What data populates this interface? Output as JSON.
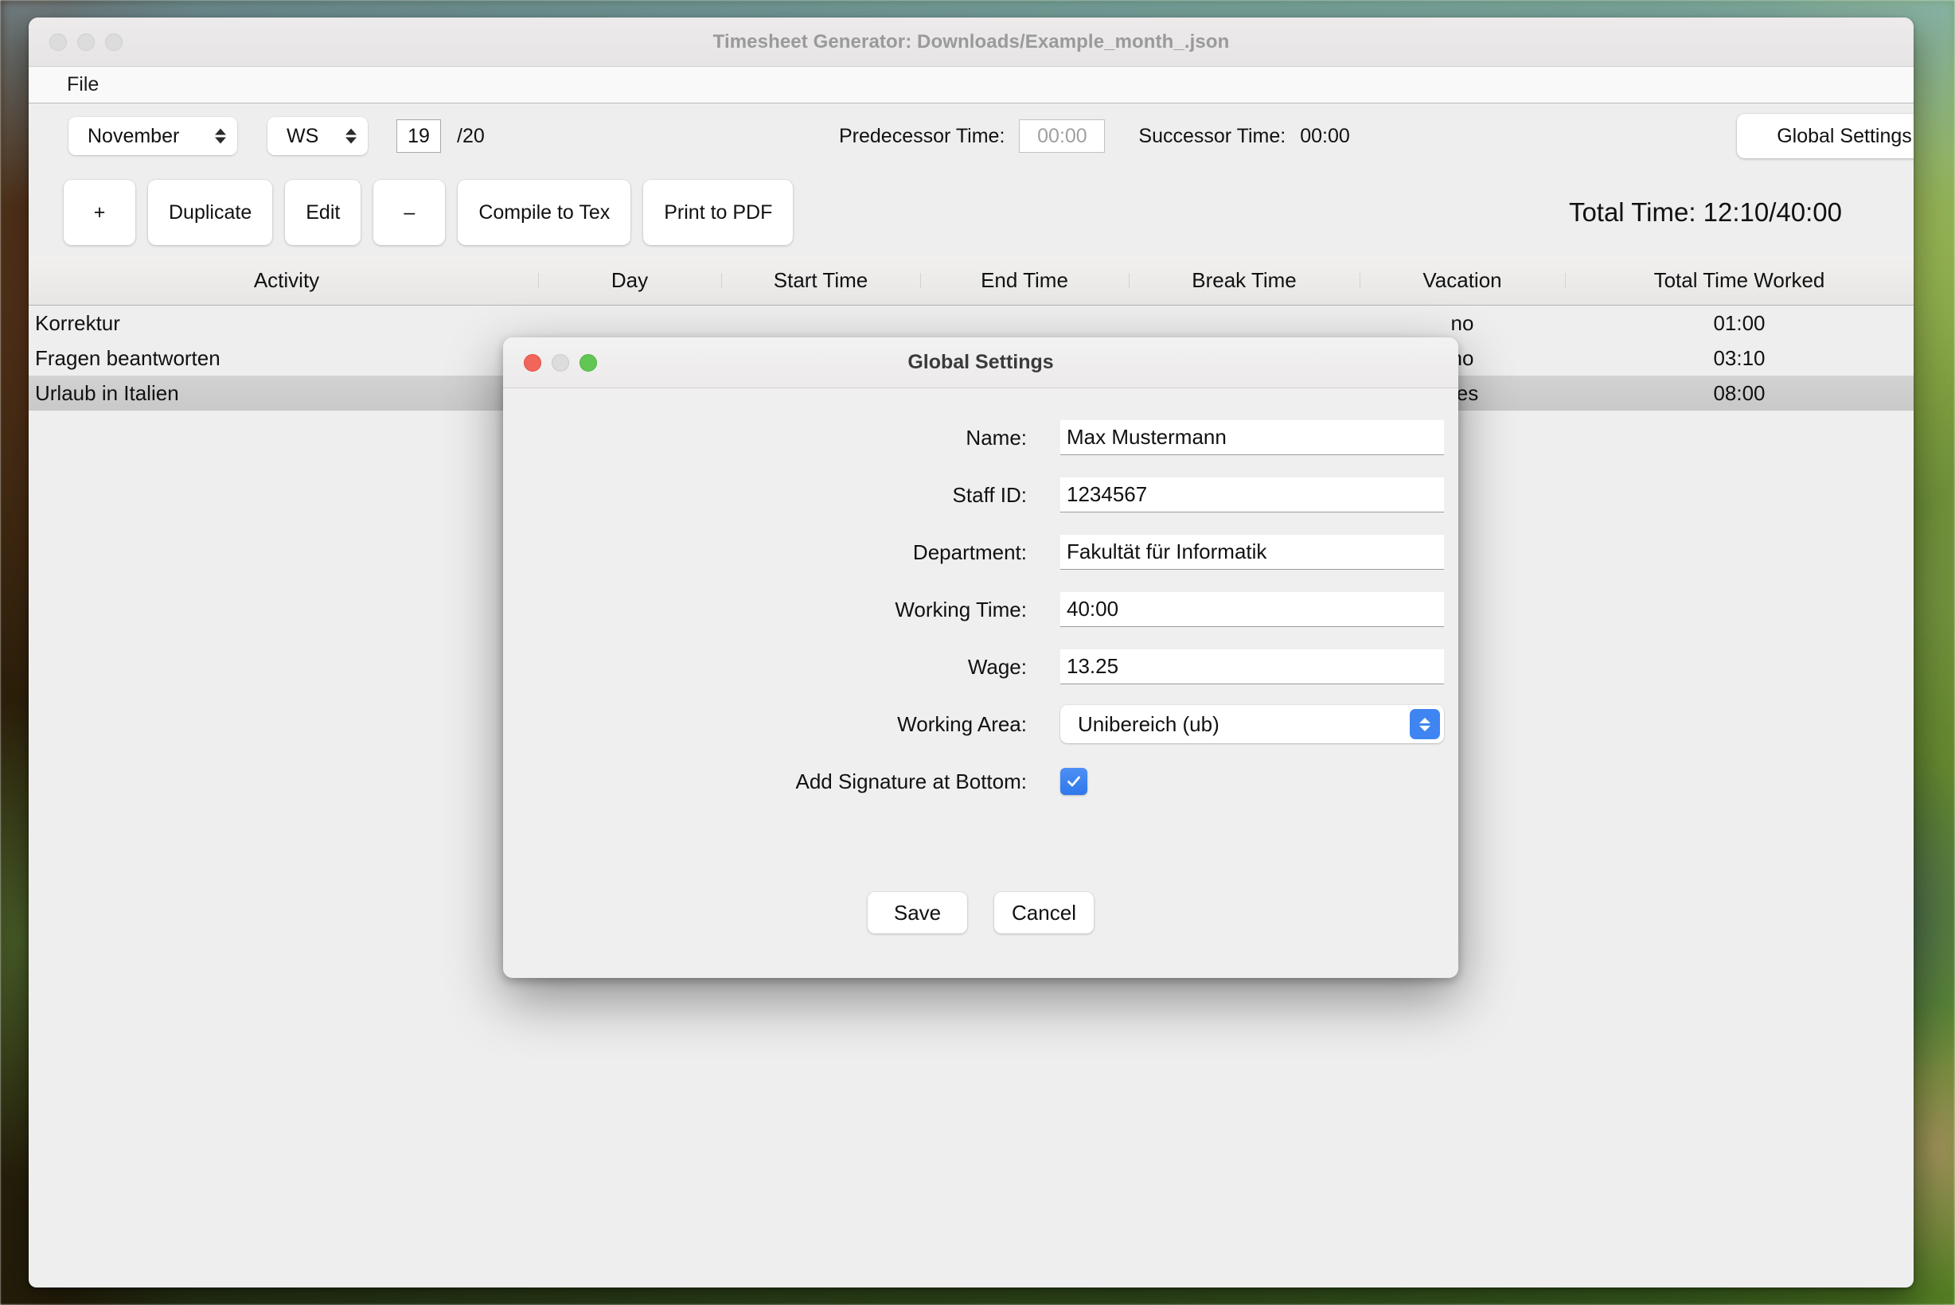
{
  "window": {
    "title": "Timesheet Generator: Downloads/Example_month_.json",
    "menu": {
      "file": "File"
    }
  },
  "toolbar": {
    "month": "November",
    "semester": "WS",
    "week_number": "19",
    "week_total": "/20",
    "predecessor_label": "Predecessor Time:",
    "predecessor_value": "00:00",
    "successor_label": "Successor Time:",
    "successor_value": "00:00",
    "global_settings": "Global Settings"
  },
  "actions": {
    "add": "+",
    "duplicate": "Duplicate",
    "edit": "Edit",
    "remove": "–",
    "compile": "Compile to Tex",
    "print": "Print to PDF",
    "total_time": "Total Time:  12:10/40:00"
  },
  "table": {
    "columns": [
      "Activity",
      "Day",
      "Start Time",
      "End Time",
      "Break Time",
      "Vacation",
      "Total Time Worked"
    ],
    "rows": [
      {
        "activity": "Korrektur",
        "day": "",
        "start": "",
        "end": "",
        "break": "",
        "vacation": "no",
        "total": "01:00",
        "selected": false
      },
      {
        "activity": "Fragen beantworten",
        "day": "",
        "start": "",
        "end": "",
        "break": "",
        "vacation": "no",
        "total": "03:10",
        "selected": false
      },
      {
        "activity": "Urlaub in Italien",
        "day": "",
        "start": "",
        "end": "",
        "break": "",
        "vacation": "yes",
        "total": "08:00",
        "selected": true
      }
    ]
  },
  "dialog": {
    "title": "Global Settings",
    "fields": {
      "name_label": "Name:",
      "name_value": "Max Mustermann",
      "staff_id_label": "Staff ID:",
      "staff_id_value": "1234567",
      "department_label": "Department:",
      "department_value": "Fakultät für Informatik",
      "working_time_label": "Working Time:",
      "working_time_value": "40:00",
      "wage_label": "Wage:",
      "wage_value": "13.25",
      "working_area_label": "Working Area:",
      "working_area_value": "Unibereich (ub)",
      "signature_label": "Add Signature at Bottom:"
    },
    "save": "Save",
    "cancel": "Cancel"
  },
  "colors": {
    "accent_blue": "#3f85f2",
    "checkbox_blue": "#4d90f5",
    "window_chrome": "#eeeeee",
    "selected_row": "#d0d0d0",
    "traffic_red": "#f2655b",
    "traffic_green": "#62c655"
  }
}
